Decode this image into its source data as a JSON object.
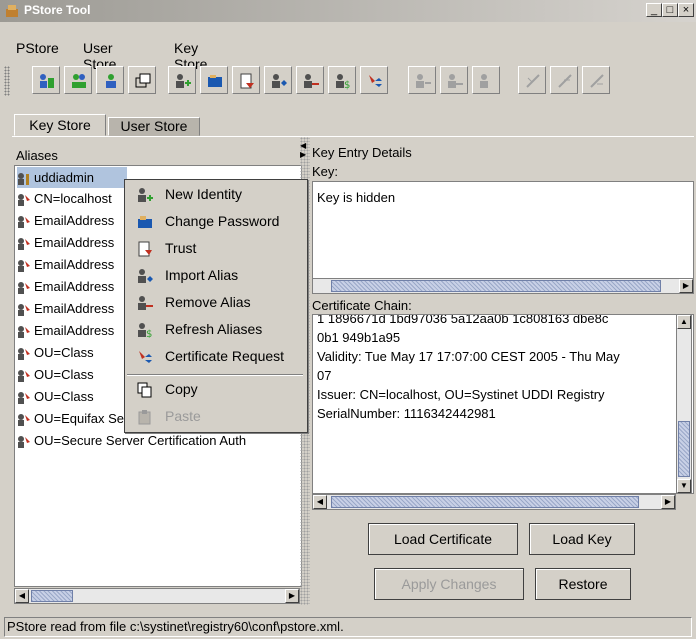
{
  "window": {
    "title": "PStore Tool",
    "controls": [
      "_",
      "□",
      "×"
    ]
  },
  "menu": [
    "PStore",
    "User Store",
    "Key Store"
  ],
  "tabs": {
    "active": "Key Store",
    "inactive": "User Store"
  },
  "aliases": {
    "header": "Aliases",
    "items": [
      "uddiadmin",
      "CN=localhost",
      "EmailAddress",
      "EmailAddress",
      "EmailAddress",
      "EmailAddress",
      "EmailAddress",
      "EmailAddress",
      "OU=Class",
      "OU=Class",
      "OU=Class",
      "OU=Equifax Secure Certificate Auth",
      "OU=Secure Server Certification Auth"
    ]
  },
  "context_menu": [
    {
      "label": "New Identity",
      "icon": "new-identity-icon",
      "enabled": true
    },
    {
      "label": "Change Password",
      "icon": "change-password-icon",
      "enabled": true
    },
    {
      "label": "Trust",
      "icon": "trust-icon",
      "enabled": true
    },
    {
      "label": "Import Alias",
      "icon": "import-alias-icon",
      "enabled": true
    },
    {
      "label": "Remove Alias",
      "icon": "remove-alias-icon",
      "enabled": true
    },
    {
      "label": "Refresh Aliases",
      "icon": "refresh-aliases-icon",
      "enabled": true
    },
    {
      "label": "Certificate Request",
      "icon": "certificate-request-icon",
      "enabled": true
    },
    {
      "label": "Copy",
      "icon": "copy-icon",
      "enabled": true
    },
    {
      "label": "Paste",
      "icon": "paste-icon",
      "enabled": false
    }
  ],
  "details": {
    "header": "Key Entry Details",
    "key_label": "Key:",
    "key_text": "Key is hidden",
    "chain_label": "Certificate Chain:",
    "chain_lines": [
      "1 1896671d 1bd97036 5a12aa0b 1c808163 dbe8c",
      "0b1 949b1a95",
      "Validity: Tue May 17 17:07:00 CEST 2005 - Thu May",
      "07",
      "Issuer: CN=localhost, OU=Systinet UDDI Registry",
      "SerialNumber: 1116342442981"
    ]
  },
  "buttons": {
    "load_certificate": "Load Certificate",
    "load_key": "Load Key",
    "apply_changes": "Apply Changes",
    "restore": "Restore"
  },
  "status": "PStore read from file c:\\systinet\\registry60\\conf\\pstore.xml.",
  "colors": {
    "selection": "#b0c4de",
    "thumb": "#9aa8c8",
    "accent_blue": "#1a58b0",
    "accent_red": "#c03020"
  }
}
